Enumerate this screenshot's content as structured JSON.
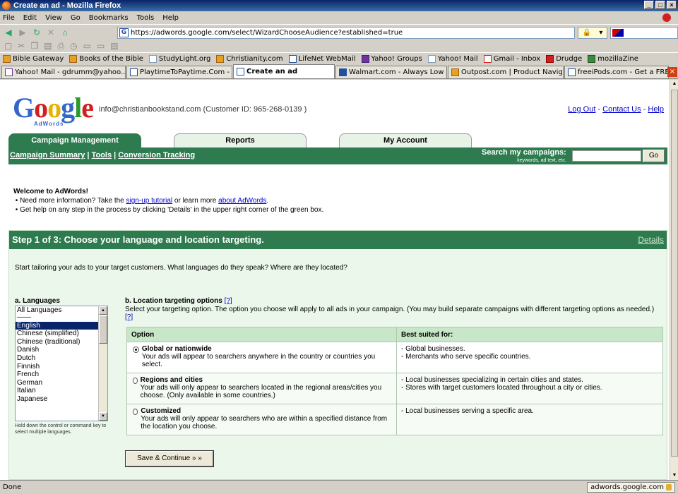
{
  "window": {
    "title": "Create an ad - Mozilla Firefox"
  },
  "menu": [
    "File",
    "Edit",
    "View",
    "Go",
    "Bookmarks",
    "Tools",
    "Help"
  ],
  "url": "https://adwords.google.com/select/WizardChooseAudience?established=true",
  "bookmarks": [
    "Bible Gateway",
    "Books of the Bible",
    "StudyLight.org",
    "Christianity.com",
    "LifeNet WebMail",
    "Yahoo! Groups",
    "Yahoo! Mail",
    "Gmail - Inbox",
    "Drudge",
    "mozillaZine"
  ],
  "tabs": [
    {
      "label": "Yahoo! Mail - gdrumm@yahoo...",
      "active": false
    },
    {
      "label": "PlaytimeToPaytime.Com - Ho...",
      "active": false
    },
    {
      "label": "Create an ad",
      "active": true
    },
    {
      "label": "Walmart.com - Always Low Pr...",
      "active": false
    },
    {
      "label": "Outpost.com | Product Navig...",
      "active": false
    },
    {
      "label": "freeiPods.com - Get a FREE iP...",
      "active": false
    }
  ],
  "header": {
    "logo": "Google",
    "logo_sub": "AdWords",
    "account": "info@christianbookstand.com (Customer ID: 965-268-0139 )",
    "logout": "Log Out",
    "contact": "Contact Us",
    "help": "Help"
  },
  "nav": {
    "tabs": [
      "Campaign Management",
      "Reports",
      "My Account"
    ],
    "sublinks": [
      "Campaign Summary",
      "Tools",
      "Conversion Tracking"
    ],
    "search_label": "Search my campaigns:",
    "search_hint": "keywords, ad text, etc.",
    "go": "Go"
  },
  "welcome": {
    "title": "Welcome to AdWords!",
    "line1_pre": "Need more information? Take the ",
    "line1_link1": "sign-up tutorial",
    "line1_mid": " or learn more ",
    "line1_link2": "about AdWords",
    "line1_post": ".",
    "line2": "Get help on any step in the process by clicking 'Details' in the upper right corner of the green box."
  },
  "step": {
    "title": "Step 1 of 3: Choose your language and location targeting.",
    "details": "Details",
    "intro": "Start tailoring your ads to your target customers. What languages do they speak? Where are they located?",
    "languages_label": "a. Languages",
    "languages": [
      "All Languages",
      "English",
      "Chinese (simplified)",
      "Chinese (traditional)",
      "Danish",
      "Dutch",
      "Finnish",
      "French",
      "German",
      "Italian",
      "Japanese"
    ],
    "selected_language": "English",
    "languages_hint": "Hold down the control or command key to select multiple languages.",
    "location_label": "b. Location targeting options",
    "help_link": "[?]",
    "location_desc": "Select your targeting option. The option you choose will apply to all ads in your campaign. (You may build separate campaigns with different targeting options as needed.)",
    "table_headers": [
      "Option",
      "Best suited for:"
    ],
    "options": [
      {
        "title": "Global or nationwide",
        "desc": "Your ads will appear to searchers anywhere in the country or countries you select.",
        "best": [
          "- Global businesses.",
          "- Merchants who serve specific countries."
        ],
        "selected": true
      },
      {
        "title": "Regions and cities",
        "desc": "Your ads will only appear to searchers located in the regional areas/cities you choose. (Only available in some countries.)",
        "best": [
          "- Local businesses specializing in certain cities and states.",
          "- Stores with target customers located throughout a city or cities."
        ],
        "selected": false
      },
      {
        "title": "Customized",
        "desc": "Your ads will only appear to searchers who are within a specified distance from the location you choose.",
        "best": [
          "- Local businesses serving a specific area."
        ],
        "selected": false
      }
    ],
    "save_button": "Save & Continue » »"
  },
  "status": {
    "text": "Done",
    "domain": "adwords.google.com"
  }
}
